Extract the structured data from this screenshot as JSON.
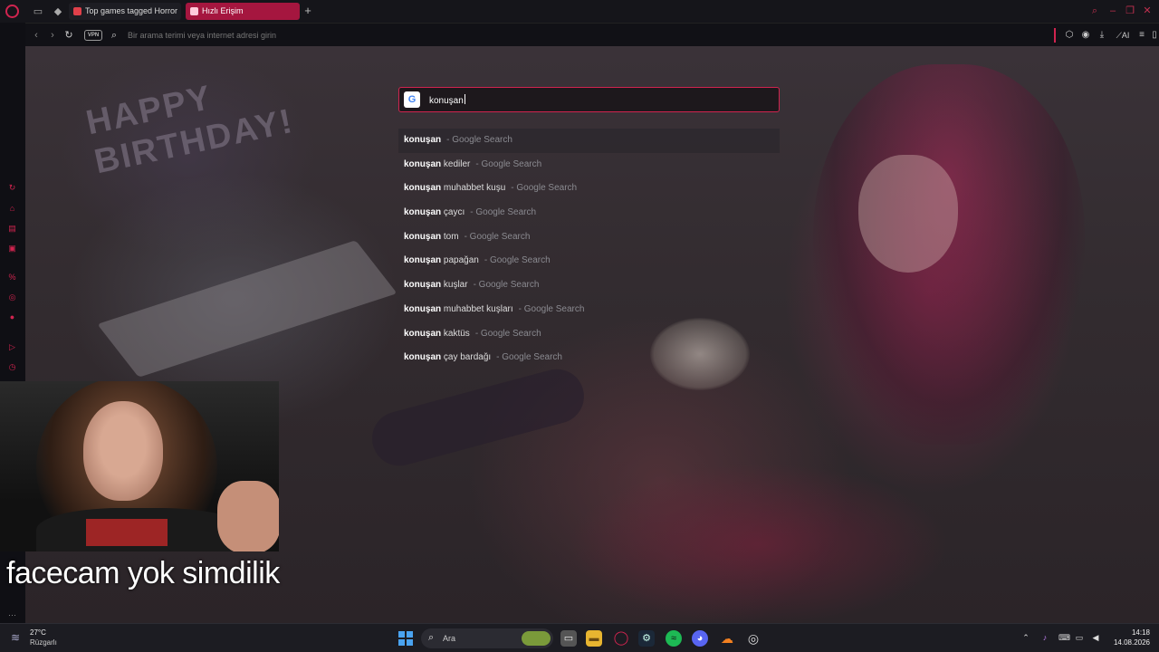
{
  "browser": {
    "tabs": [
      {
        "label": "Top games tagged Horror"
      },
      {
        "label": "Hızlı Erişim"
      }
    ],
    "new_tab_symbol": "+",
    "address_placeholder": "Bir arama terimi veya internet adresi girin",
    "vpn_label": "VPN",
    "ai_label": "AI",
    "accent_color": "#d0244f"
  },
  "wallpaper": {
    "sign_line1": "HAPPY",
    "sign_line2": "BIRTHDAY!"
  },
  "search": {
    "engine": "G",
    "value": "konuşan"
  },
  "suggestions": [
    {
      "bold": "konuşan",
      "rest": "",
      "source": "- Google Search"
    },
    {
      "bold": "konuşan",
      "rest": " kediler",
      "source": "- Google Search"
    },
    {
      "bold": "konuşan",
      "rest": " muhabbet kuşu",
      "source": "- Google Search"
    },
    {
      "bold": "konuşan",
      "rest": " çaycı",
      "source": "- Google Search"
    },
    {
      "bold": "konuşan",
      "rest": " tom",
      "source": "- Google Search"
    },
    {
      "bold": "konuşan",
      "rest": " papağan",
      "source": "- Google Search"
    },
    {
      "bold": "konuşan",
      "rest": " kuşlar",
      "source": "- Google Search"
    },
    {
      "bold": "konuşan",
      "rest": " muhabbet kuşları",
      "source": "- Google Search"
    },
    {
      "bold": "konuşan",
      "rest": " kaktüs",
      "source": "- Google Search"
    },
    {
      "bold": "konuşan",
      "rest": " çay bardağı",
      "source": "- Google Search"
    }
  ],
  "overlay": {
    "caption": "facecam yok simdilik"
  },
  "taskbar": {
    "weather_temp": "27°C",
    "weather_desc": "Rüzgarlı",
    "search_label": "Ara",
    "time": "14:18",
    "date": "14.08.2026"
  }
}
